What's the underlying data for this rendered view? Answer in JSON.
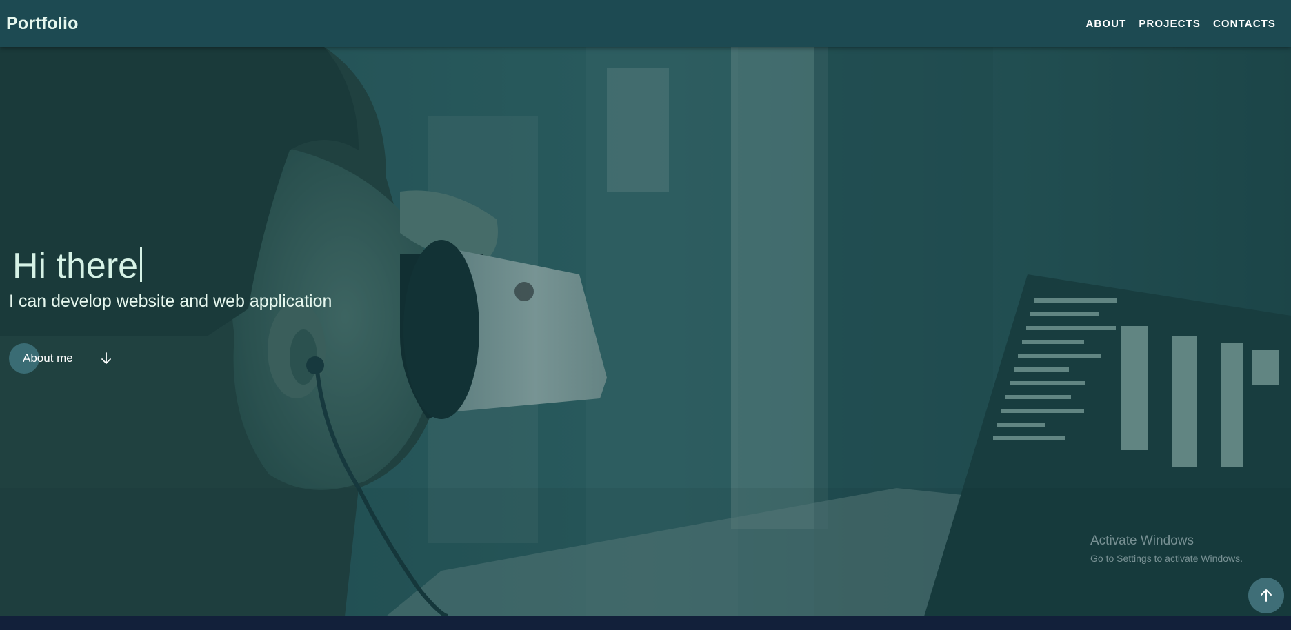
{
  "nav": {
    "brand": "Portfolio",
    "links": [
      "ABOUT",
      "PROJECTS",
      "CONTACTS"
    ]
  },
  "hero": {
    "title": "Hi there",
    "subtitle": "I can develop website and web application",
    "about_button": "About me"
  },
  "icons": {
    "about_arrow": "arrow-down-icon",
    "scroll_top": "arrow-up-icon"
  },
  "watermark": {
    "title": "Activate Windows",
    "subtitle": "Go to Settings to activate Windows."
  },
  "colors": {
    "navbar": "#1d4a52",
    "hero_overlay": "#14484c",
    "text": "#d6f2e6",
    "footer": "#12203a"
  }
}
